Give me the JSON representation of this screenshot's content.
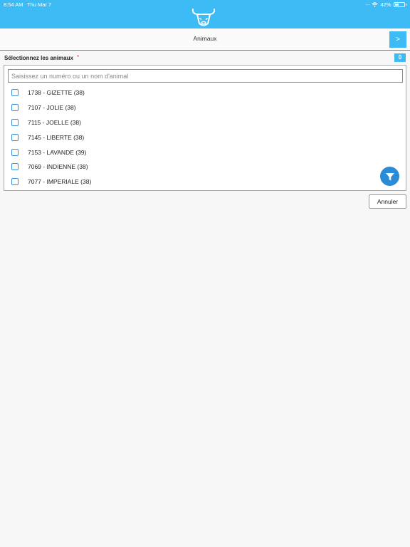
{
  "status_bar": {
    "time": "8:54 AM",
    "date": "Thu Mar 7",
    "signal": ".....",
    "battery_text": "42%",
    "battery_level": 0.42
  },
  "header": {
    "logo_icon": "cow-head-icon",
    "title": "Animaux",
    "next_label": ">"
  },
  "selection": {
    "label": "Sélectionnez les animaux",
    "required_marker": "*",
    "count": "0"
  },
  "search": {
    "placeholder": "Saisissez un numéro ou un nom d'animal",
    "value": ""
  },
  "animals": [
    {
      "label": "1738 - GIZETTE (38)",
      "checked": false
    },
    {
      "label": "7107 - JOLIE (38)",
      "checked": false
    },
    {
      "label": "7115 - JOELLE (38)",
      "checked": false
    },
    {
      "label": "7145 - LIBERTE (38)",
      "checked": false
    },
    {
      "label": "7153 - LAVANDE (39)",
      "checked": false
    },
    {
      "label": "7069 - INDIENNE (38)",
      "checked": false
    },
    {
      "label": "7077 - IMPERIALE (38)",
      "checked": false
    }
  ],
  "filter_icon": "filter-funnel-icon",
  "actions": {
    "cancel_label": "Annuler"
  },
  "colors": {
    "accent": "#3dbbf5",
    "filter": "#2b8bd4",
    "checkbox": "#3d8fd6",
    "required": "#e53935"
  }
}
